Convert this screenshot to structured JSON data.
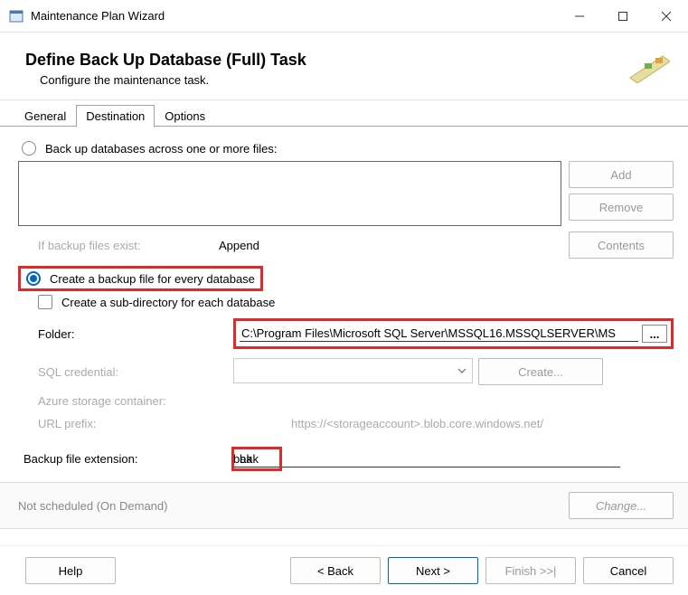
{
  "window": {
    "title": "Maintenance Plan Wizard"
  },
  "header": {
    "title": "Define Back Up Database (Full) Task",
    "subtitle": "Configure the maintenance task."
  },
  "tabs": {
    "items": [
      "General",
      "Destination",
      "Options"
    ],
    "active": 1
  },
  "dest": {
    "option_files_label": "Back up databases across one or more files:",
    "add_label": "Add",
    "remove_label": "Remove",
    "contents_label": "Contents",
    "if_exist_label": "If backup files exist:",
    "if_exist_value": "Append",
    "option_every_label": "Create a backup file for every database",
    "subdir_label": "Create a sub-directory for each database",
    "folder_label": "Folder:",
    "folder_value": "C:\\Program Files\\Microsoft SQL Server\\MSSQL16.MSSQLSERVER\\MS",
    "browse_label": "...",
    "sql_cred_label": "SQL credential:",
    "create_label": "Create...",
    "azure_label": "Azure storage container:",
    "url_label": "URL prefix:",
    "url_value": "https://<storageaccount>.blob.core.windows.net/",
    "ext_label": "Backup file extension:",
    "ext_value": "bak"
  },
  "schedule": {
    "text": "Not scheduled (On Demand)",
    "change_label": "Change..."
  },
  "footer": {
    "help": "Help",
    "back": "< Back",
    "next": "Next >",
    "finish": "Finish >>|",
    "cancel": "Cancel"
  }
}
